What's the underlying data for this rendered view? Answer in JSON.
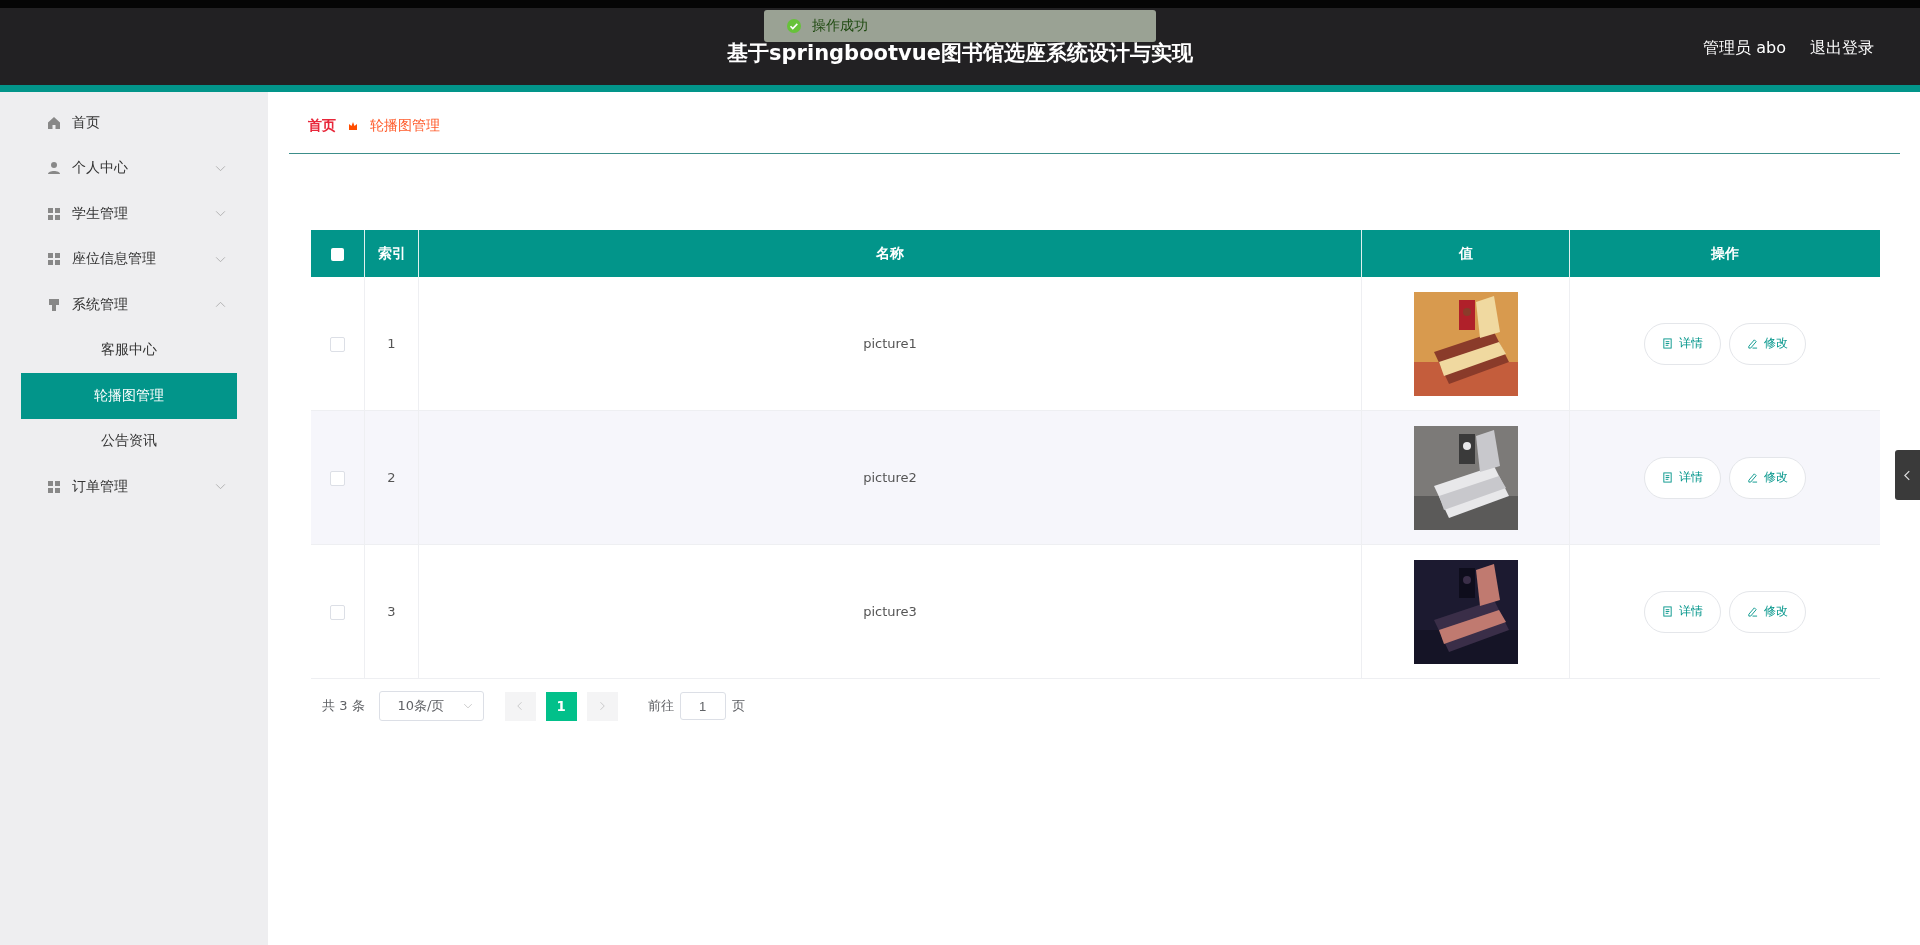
{
  "header": {
    "title": "基于springbootvue图书馆选座系统设计与实现",
    "user": "管理员 abo",
    "logout": "退出登录"
  },
  "toast": {
    "text": "操作成功"
  },
  "sidebar": {
    "items": [
      {
        "label": "首页",
        "kind": "link"
      },
      {
        "label": "个人中心",
        "kind": "submenu"
      },
      {
        "label": "学生管理",
        "kind": "submenu"
      },
      {
        "label": "座位信息管理",
        "kind": "submenu"
      },
      {
        "label": "系统管理",
        "kind": "submenu",
        "expanded": true,
        "children": [
          {
            "label": "客服中心",
            "selected": false
          },
          {
            "label": "轮播图管理",
            "selected": true
          },
          {
            "label": "公告资讯",
            "selected": false
          }
        ]
      },
      {
        "label": "订单管理",
        "kind": "submenu"
      }
    ]
  },
  "breadcrumb": [
    "首页",
    "轮播图管理"
  ],
  "table": {
    "all_checked": false,
    "columns": [
      "索引",
      "名称",
      "值",
      "操作"
    ],
    "rows": [
      {
        "checked": false,
        "index": "1",
        "name": "picture1",
        "value": {
          "kind": "picture"
        },
        "actions": [
          "详情",
          "修改"
        ]
      },
      {
        "checked": false,
        "index": "2",
        "name": "picture2",
        "value": {
          "kind": "picture"
        },
        "actions": [
          "详情",
          "修改"
        ]
      },
      {
        "checked": false,
        "index": "3",
        "name": "picture3",
        "value": {
          "kind": "picture"
        },
        "actions": [
          "详情",
          "修改"
        ]
      }
    ]
  },
  "pagination": {
    "total": "共 3 条",
    "page_size": "10条/页",
    "pages": [
      {
        "label": "1",
        "selected": true
      }
    ],
    "goto_label": "前往",
    "goto_value": "1",
    "goto_suffix": "页"
  }
}
